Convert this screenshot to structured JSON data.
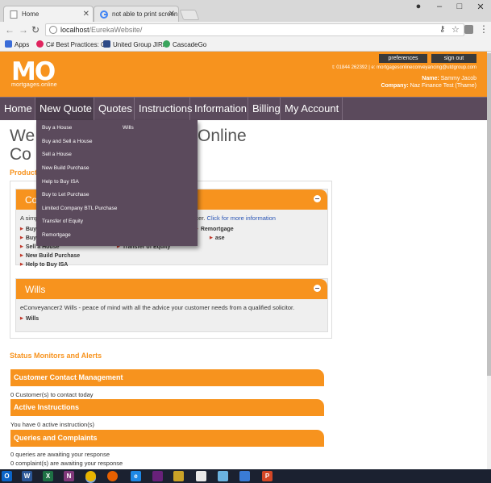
{
  "browser": {
    "tabs": [
      {
        "title": "Home",
        "active": true
      },
      {
        "title": "not able to print screen o",
        "active": false
      }
    ],
    "url_host": "localhost",
    "url_path": "/EurekaWebsite/",
    "bookmarks": [
      {
        "label": "Apps",
        "icon": "apps-grid-icon",
        "color": "#3b6dd8"
      },
      {
        "label": "C# Best Practices: Co",
        "icon": "cs-icon",
        "color": "#e0245e"
      },
      {
        "label": "United Group JIRA",
        "icon": "jira-icon",
        "color": "#2d4a86"
      },
      {
        "label": "CascadeGo",
        "icon": "cascade-icon",
        "color": "#3aa55d"
      }
    ]
  },
  "header": {
    "logo_main": "MO",
    "logo_sub": "mortgages.online",
    "preferences_label": "preferences",
    "signout_label": "sign out",
    "contact": "t: 01844 262392  |  e: mortgagesonlineconveyancing@utdgroup.com",
    "name_label": "Name:",
    "name_value": "Sammy Jacob",
    "company_label": "Company:",
    "company_value": "Naz Finance Test (Thame)"
  },
  "nav": {
    "items": [
      "Home",
      "New Quote",
      "Quotes",
      "Instructions",
      "Information",
      "Billing",
      "My Account"
    ]
  },
  "dropdown": {
    "col1": [
      "Buy a House",
      "Buy and Sell a House",
      "Sell a House",
      "New Build Purchase",
      "Help to Buy ISA",
      "Buy to Let Purchase",
      "Limited Company BTL Purchase",
      "Transfer of Equity",
      "Remortgage"
    ],
    "col2": [
      "Wills"
    ]
  },
  "page": {
    "welcome_left_1": "We",
    "welcome_right_1": "Online",
    "welcome_left_2": "Co",
    "products_heading": "Product",
    "panel1_title": "Co",
    "panel1_text": "A simp",
    "panel1_text_right": "ancer.",
    "panel1_link": "Click for more information",
    "panel1_links": [
      "Buy",
      "Buy",
      "Sell a House",
      "New Build Purchase",
      "Help to Buy ISA",
      "Transfer of Equity",
      "ase",
      "Remortgage"
    ],
    "panel2_title": "Wills",
    "panel2_text": "eConveyancer2 Wills - peace of mind with all the advice your customer needs from a qualified solicitor.",
    "panel2_links": [
      "Wills"
    ],
    "status_heading": "Status Monitors and Alerts",
    "sections": [
      {
        "title": "Customer Contact Management",
        "text": "0 Customer(s) to contact today"
      },
      {
        "title": "Active Instructions",
        "text": "You have 0 active instruction(s)"
      },
      {
        "title": "Queries and Complaints",
        "text": "0 queries are awaiting your response"
      }
    ],
    "cut_text": "0 complaint(s) are awaiting your response"
  },
  "taskbar": {
    "apps": [
      {
        "label": "O",
        "icon": "outlook-icon",
        "color": "#0a64c8"
      },
      {
        "label": "W",
        "icon": "word-icon",
        "color": "#2b5797"
      },
      {
        "label": "X",
        "icon": "excel-icon",
        "color": "#1e7145"
      },
      {
        "label": "N",
        "icon": "onenote-icon",
        "color": "#80397b"
      },
      {
        "label": "",
        "icon": "chrome-icon",
        "color": "#e8b400"
      },
      {
        "label": "",
        "icon": "firefox-icon",
        "color": "#e66000"
      },
      {
        "label": "e",
        "icon": "ie-icon",
        "color": "#1e88e5"
      },
      {
        "label": "",
        "icon": "visual-studio-icon",
        "color": "#68217a"
      },
      {
        "label": "",
        "icon": "sql-tool-icon",
        "color": "#c9a227"
      },
      {
        "label": "",
        "icon": "notepad-icon",
        "color": "#e8e8e8"
      },
      {
        "label": "",
        "icon": "paint-icon",
        "color": "#6bb3e0"
      },
      {
        "label": "",
        "icon": "remote-desktop-icon",
        "color": "#3a7bd5"
      },
      {
        "label": "P",
        "icon": "powerpoint-icon",
        "color": "#d24726"
      }
    ]
  }
}
